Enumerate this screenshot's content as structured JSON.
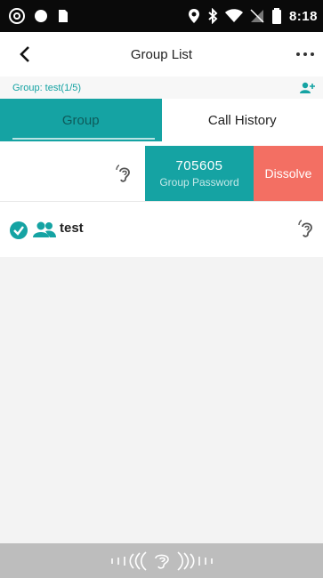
{
  "status_bar": {
    "time": "8:18"
  },
  "header": {
    "title": "Group List"
  },
  "group_info": {
    "text": "Group: test(1/5)"
  },
  "tabs": [
    {
      "label": "Group",
      "active": true
    },
    {
      "label": "Call History",
      "active": false
    }
  ],
  "swipe_row": {
    "password": "705605",
    "password_label": "Group Password",
    "dissolve_label": "Dissolve"
  },
  "groups": [
    {
      "name": "test",
      "selected": true
    }
  ],
  "colors": {
    "accent": "#15a3a3",
    "dissolve": "#f36f63",
    "status_bar": "#0a0a0a",
    "bottom_bar": "#bdbdbd"
  }
}
